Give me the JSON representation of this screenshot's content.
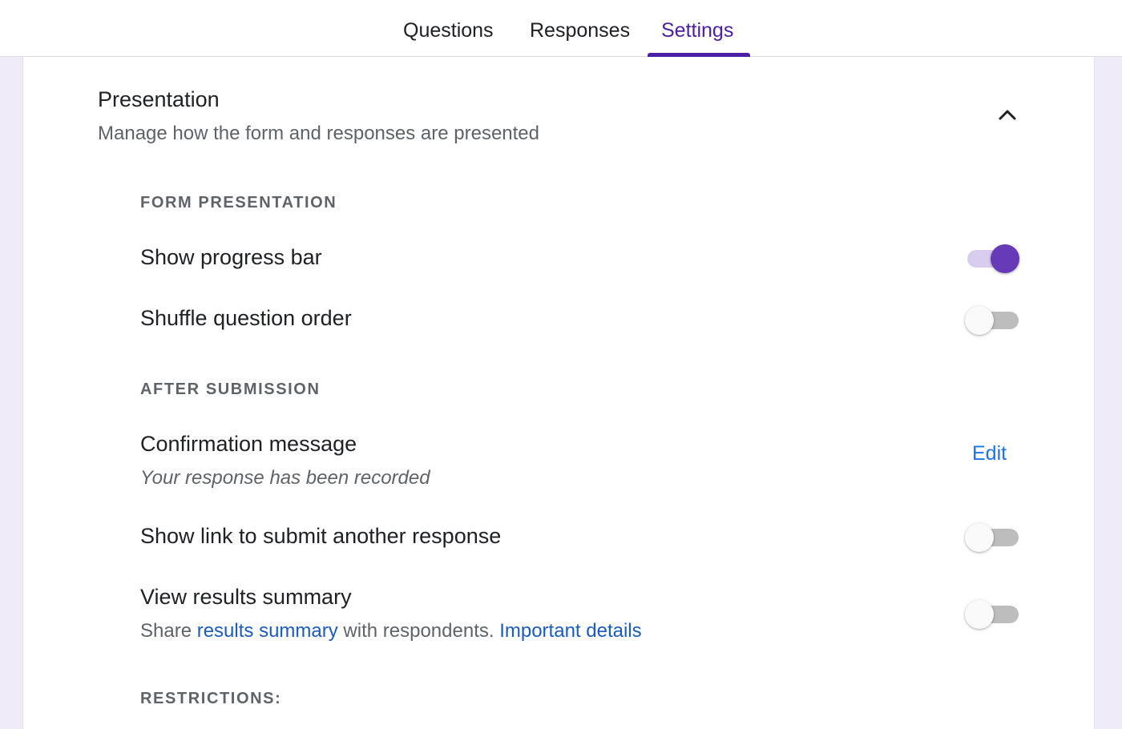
{
  "tabs": [
    {
      "label": "Questions",
      "active": false
    },
    {
      "label": "Responses",
      "active": false
    },
    {
      "label": "Settings",
      "active": true
    }
  ],
  "section": {
    "title": "Presentation",
    "subtitle": "Manage how the form and responses are presented",
    "collapse_icon": "chevron-up-icon"
  },
  "form_presentation": {
    "label": "FORM PRESENTATION",
    "show_progress_bar": {
      "label": "Show progress bar",
      "enabled": true
    },
    "shuffle_question_order": {
      "label": "Shuffle question order",
      "enabled": false
    }
  },
  "after_submission": {
    "label": "AFTER SUBMISSION",
    "confirmation_message": {
      "label": "Confirmation message",
      "value": "Your response has been recorded",
      "edit_label": "Edit"
    },
    "submit_another_link": {
      "label": "Show link to submit another response",
      "enabled": false
    },
    "view_results_summary": {
      "label": "View results summary",
      "desc_prefix": "Share",
      "desc_link": "results summary",
      "desc_middle": "with respondents.",
      "details_link": "Important details",
      "enabled": false
    }
  },
  "restrictions": {
    "label": "RESTRICTIONS:"
  },
  "colors": {
    "accent": "#673ab7",
    "tab_active": "#4b1fa6",
    "link": "#1a73e8",
    "page_background": "#f0ebf8"
  }
}
